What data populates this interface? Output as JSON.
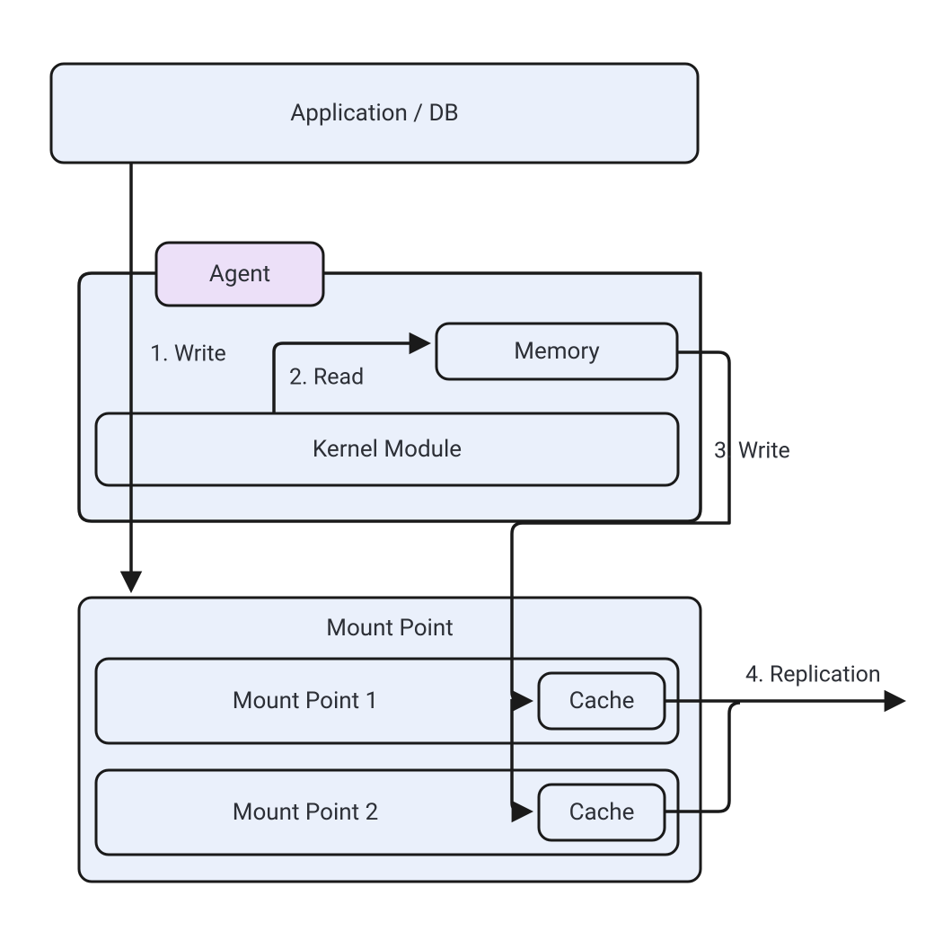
{
  "colors": {
    "blueFill": "#eaf0fb",
    "purpleFill": "#ece0f8",
    "stroke": "#1a1a1a",
    "text": "#2c2f36"
  },
  "nodes": {
    "application": {
      "label": "Application / DB"
    },
    "agentContainer": {
      "label": ""
    },
    "agent": {
      "label": "Agent"
    },
    "memory": {
      "label": "Memory"
    },
    "kernelModule": {
      "label": "Kernel Module"
    },
    "mountPointGroup": {
      "label": "Mount Point"
    },
    "mountPoint1": {
      "label": "Mount Point 1"
    },
    "mountPoint2": {
      "label": "Mount Point 2"
    },
    "cache1": {
      "label": "Cache"
    },
    "cache2": {
      "label": "Cache"
    }
  },
  "edges": {
    "write1": {
      "label": "1. Write"
    },
    "read2": {
      "label": "2. Read"
    },
    "write3": {
      "label": "3. Write"
    },
    "replication4": {
      "label": "4. Replication"
    }
  }
}
